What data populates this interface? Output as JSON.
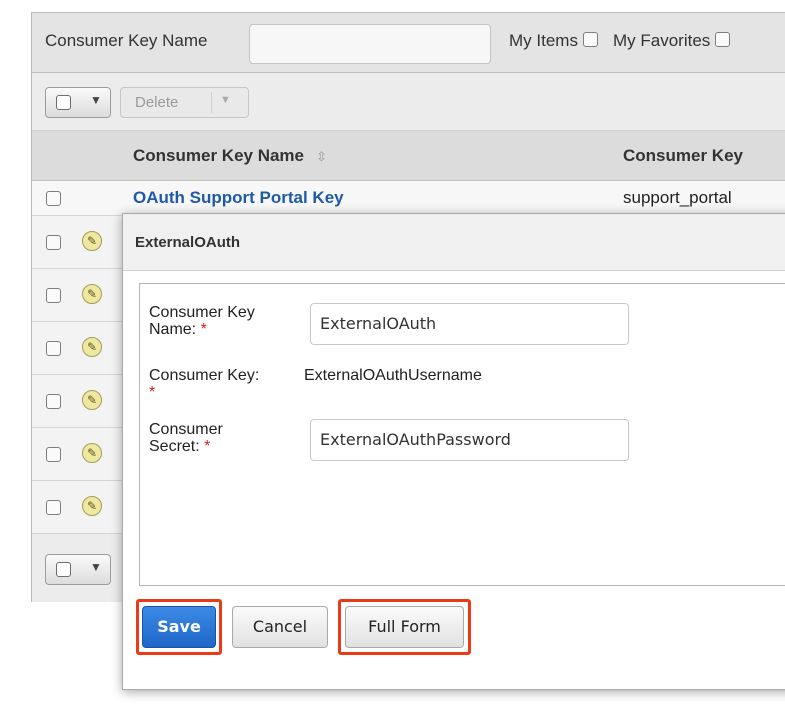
{
  "filter": {
    "name_label": "Consumer Key Name",
    "name_value": "",
    "my_items_label": "My Items",
    "my_favorites_label": "My Favorites"
  },
  "actions": {
    "delete_label": "Delete"
  },
  "table": {
    "columns": [
      "Consumer Key Name",
      "Consumer Key"
    ],
    "rows": [
      {
        "name": "OAuth Support Portal Key",
        "key": "support_portal"
      }
    ]
  },
  "modal": {
    "title": "ExternalOAuth",
    "fields": {
      "name_label_line1": "Consumer Key",
      "name_label_line2": "Name:",
      "name_value": "ExternalOAuth",
      "key_label": "Consumer Key:",
      "key_value": "ExternalOAuthUsername",
      "secret_label_line1": "Consumer",
      "secret_label_line2": "Secret:",
      "secret_value": "ExternalOAuthPassword",
      "required_mark": "*"
    },
    "buttons": {
      "save": "Save",
      "cancel": "Cancel",
      "full_form": "Full Form"
    }
  },
  "colors": {
    "highlight": "#ec3a17",
    "link": "#1f5aa8",
    "primary": "#1e66c7",
    "required": "#d41e1e"
  }
}
